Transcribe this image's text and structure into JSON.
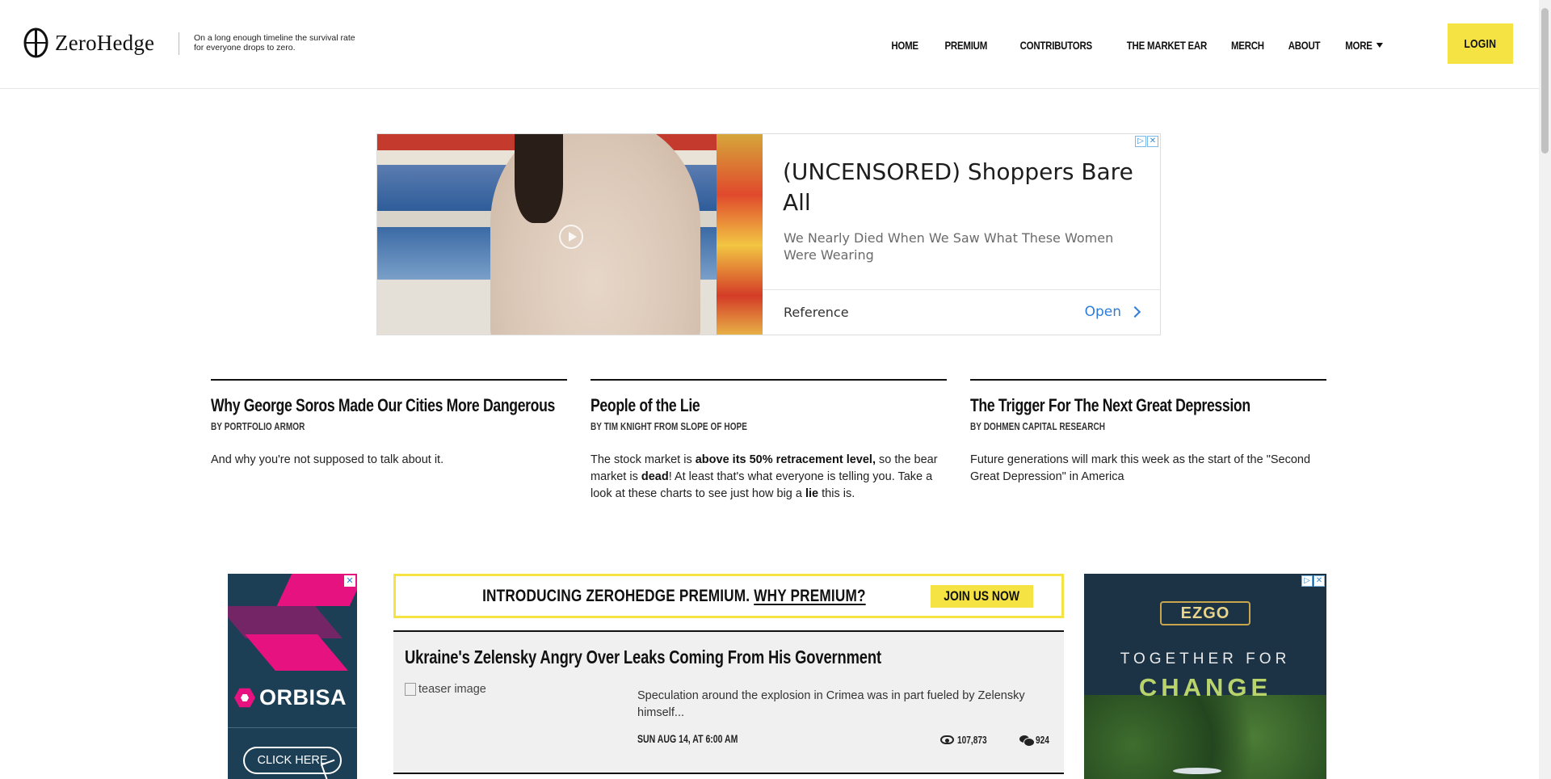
{
  "header": {
    "logo_text": "ZeroHedge",
    "tagline": "On a long enough timeline the survival rate for everyone drops to zero.",
    "nav": [
      "HOME",
      "PREMIUM",
      "CONTRIBUTORS",
      "THE MARKET EAR",
      "MERCH",
      "ABOUT",
      "MORE"
    ],
    "login_label": "LOGIN"
  },
  "top_ad": {
    "headline": "(UNCENSORED) Shoppers Bare All",
    "subtext": "We Nearly Died When We Saw What These Women Were Wearing",
    "source": "Reference",
    "cta": "Open"
  },
  "features": [
    {
      "title": "Why George Soros Made Our Cities More Dangerous",
      "byline": "BY PORTFOLIO ARMOR",
      "body_parts": [
        "And why you're not supposed to talk about it."
      ]
    },
    {
      "title": "People of the Lie",
      "byline": "BY TIM KNIGHT FROM SLOPE OF HOPE",
      "body_parts": [
        "The stock market is ",
        "above its 50% retracement level,",
        " so the bear market is ",
        "dead",
        "! At least that's what everyone is telling you. Take a look at these charts to see just how big a ",
        "lie",
        " this is."
      ]
    },
    {
      "title": "The Trigger For The Next Great Depression",
      "byline": "BY DOHMEN CAPITAL RESEARCH",
      "body_parts": [
        "Future generations will mark this week as the start of the \"Second Great Depression\" in America"
      ]
    }
  ],
  "premium_banner": {
    "intro": "INTRODUCING ZEROHEDGE PREMIUM.",
    "why": "WHY PREMIUM?",
    "join": "JOIN US NOW",
    "accent": "#f4e343"
  },
  "article": {
    "title": "Ukraine's Zelensky Angry Over Leaks Coming From His Government",
    "image_alt": "teaser image",
    "summary": "Speculation around the explosion in Crimea was in part fueled by Zelensky himself...",
    "date": "SUN AUG 14, AT 6:00 AM",
    "views": "107,873",
    "comments": "924"
  },
  "left_ad": {
    "brand": "ORBISA",
    "cta": "CLICK HERE",
    "close": "✕"
  },
  "right_ad": {
    "brand": "EZGO",
    "line1": "TOGETHER FOR",
    "line2": "CHANGE"
  }
}
